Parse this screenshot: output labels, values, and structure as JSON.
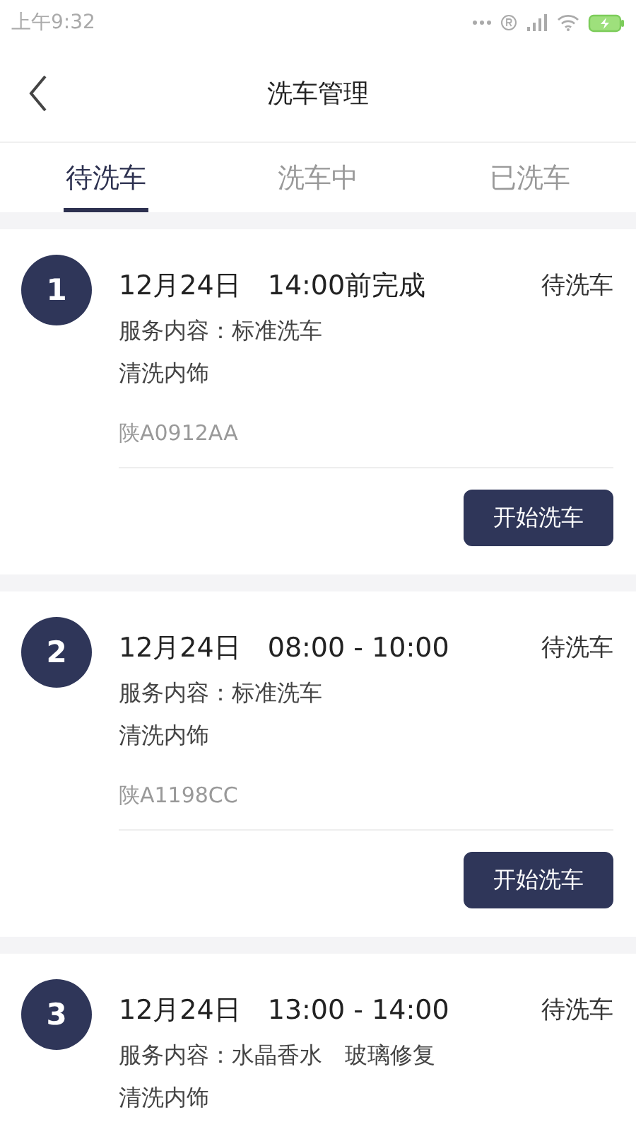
{
  "status_bar": {
    "time": "上午9:32"
  },
  "header": {
    "title": "洗车管理"
  },
  "tabs": [
    {
      "label": "待洗车",
      "selected": true
    },
    {
      "label": "洗车中",
      "selected": false
    },
    {
      "label": "已洗车",
      "selected": false
    }
  ],
  "orders": [
    {
      "number": "1",
      "date": "12月24日",
      "time": "14:00前完成",
      "status": "待洗车",
      "service": "服务内容：标准洗车",
      "extra": "清洗内饰",
      "plate": "陕A0912AA",
      "button": "开始洗车"
    },
    {
      "number": "2",
      "date": "12月24日",
      "time": "08:00 - 10:00",
      "status": "待洗车",
      "service": "服务内容：标准洗车",
      "extra": "清洗内饰",
      "plate": "陕A1198CC",
      "button": "开始洗车"
    },
    {
      "number": "3",
      "date": "12月24日",
      "time": "13:00 - 14:00",
      "status": "待洗车",
      "service": "服务内容：水晶香水　玻璃修复",
      "extra": "清洗内饰"
    }
  ]
}
